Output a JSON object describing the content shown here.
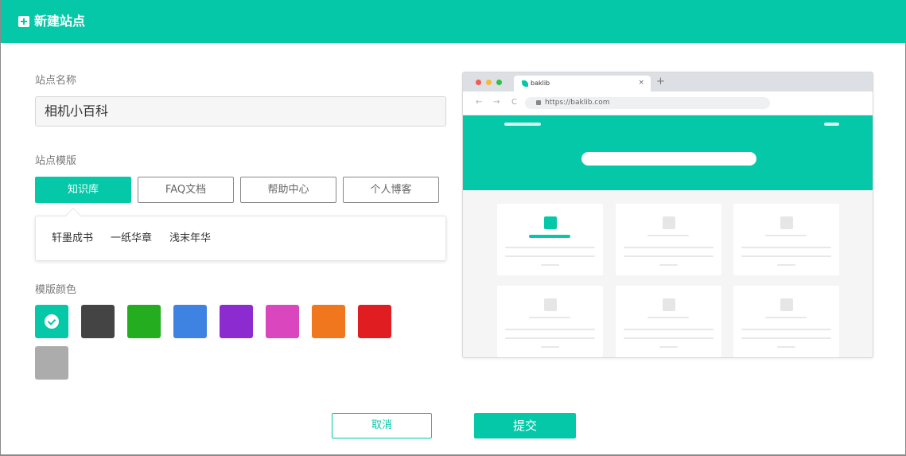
{
  "header": {
    "title": "新建站点",
    "icon": "plus-square-icon"
  },
  "form": {
    "site_name_label": "站点名称",
    "site_name_value": "相机小百科",
    "template_label": "站点模版",
    "templates": [
      {
        "label": "知识库",
        "active": true
      },
      {
        "label": "FAQ文档",
        "active": false
      },
      {
        "label": "帮助中心",
        "active": false
      },
      {
        "label": "个人博客",
        "active": false
      }
    ],
    "sub_templates": [
      "轩墨成书",
      "一纸华章",
      "浅末年华"
    ],
    "color_label": "模版颜色",
    "colors": [
      "#05c8a8",
      "#444444",
      "#23ad1f",
      "#3e82e2",
      "#8b2bd0",
      "#d946bd",
      "#f0771d",
      "#e01e22",
      "#acacac"
    ],
    "selected_color": "#05c8a8"
  },
  "preview": {
    "tab_title": "baklib",
    "tab_close": "×",
    "new_tab": "+",
    "url": "https://baklib.com",
    "nav_back": "←",
    "nav_forward": "→",
    "nav_reload": "C"
  },
  "footer": {
    "cancel_label": "取消",
    "submit_label": "提交"
  }
}
